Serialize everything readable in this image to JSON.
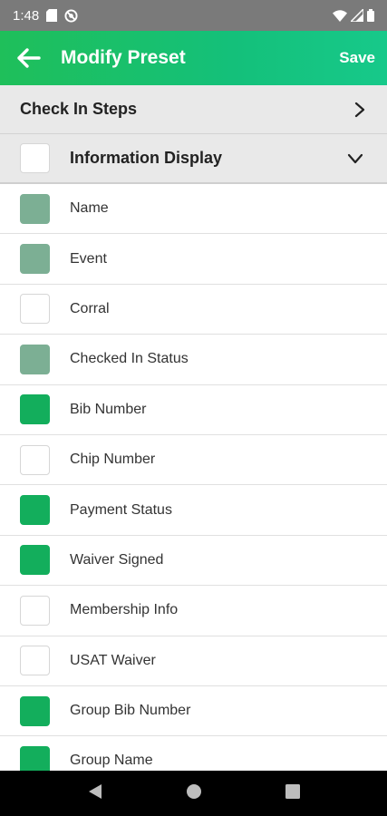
{
  "status_bar": {
    "time": "1:48"
  },
  "app_bar": {
    "title": "Modify Preset",
    "save_label": "Save"
  },
  "check_in_steps": {
    "label": "Check In Steps"
  },
  "information_display": {
    "label": "Information Display",
    "checked": false
  },
  "items": [
    {
      "label": "Name",
      "state": "disabled"
    },
    {
      "label": "Event",
      "state": "disabled"
    },
    {
      "label": "Corral",
      "state": "unchecked"
    },
    {
      "label": "Checked In Status",
      "state": "disabled"
    },
    {
      "label": "Bib Number",
      "state": "checked"
    },
    {
      "label": "Chip Number",
      "state": "unchecked"
    },
    {
      "label": "Payment Status",
      "state": "checked"
    },
    {
      "label": "Waiver Signed",
      "state": "checked"
    },
    {
      "label": "Membership Info",
      "state": "unchecked"
    },
    {
      "label": "USAT Waiver",
      "state": "unchecked"
    },
    {
      "label": "Group Bib Number",
      "state": "checked"
    },
    {
      "label": "Group Name",
      "state": "checked"
    }
  ],
  "colors": {
    "accent": "#13ae5c",
    "disabled_checked": "#7caf94",
    "app_bar": "#1fbf5a",
    "status_bar": "#7a7a7a"
  },
  "icons": {
    "back": "arrow-left-icon",
    "expand": "chevron-right-icon",
    "collapse": "chevron-down-icon"
  }
}
